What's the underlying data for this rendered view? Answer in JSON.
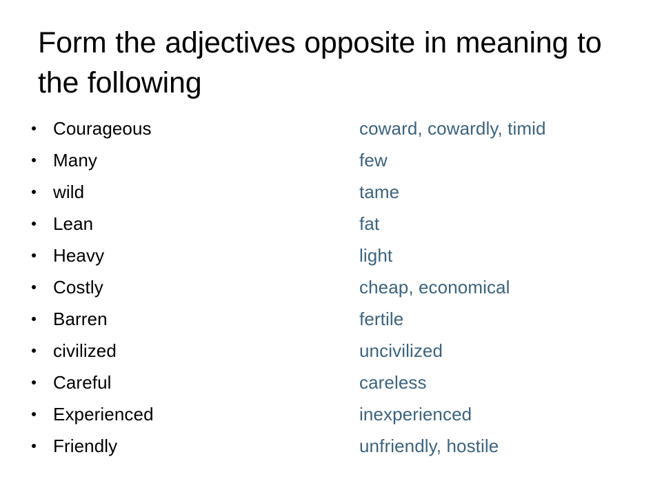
{
  "slide": {
    "title": "Form the adjectives opposite in meaning to the following",
    "background_color": "#ffffff",
    "title_color": "#000000",
    "term_color": "#000000",
    "opposite_color": "#3c637f",
    "bullet_icon": "bullet-dot-icon"
  },
  "rows": [
    {
      "term": "Courageous",
      "opposite": "coward, cowardly, timid"
    },
    {
      "term": "Many",
      "opposite": "few"
    },
    {
      "term": "wild",
      "opposite": "tame"
    },
    {
      "term": "Lean",
      "opposite": "fat"
    },
    {
      "term": "Heavy",
      "opposite": "light"
    },
    {
      "term": "Costly",
      "opposite": "cheap, economical"
    },
    {
      "term": "Barren",
      "opposite": "fertile"
    },
    {
      "term": "civilized",
      "opposite": "uncivilized"
    },
    {
      "term": "Careful",
      "opposite": "careless"
    },
    {
      "term": "Experienced",
      "opposite": "inexperienced"
    },
    {
      "term": "Friendly",
      "opposite": "unfriendly, hostile"
    }
  ]
}
